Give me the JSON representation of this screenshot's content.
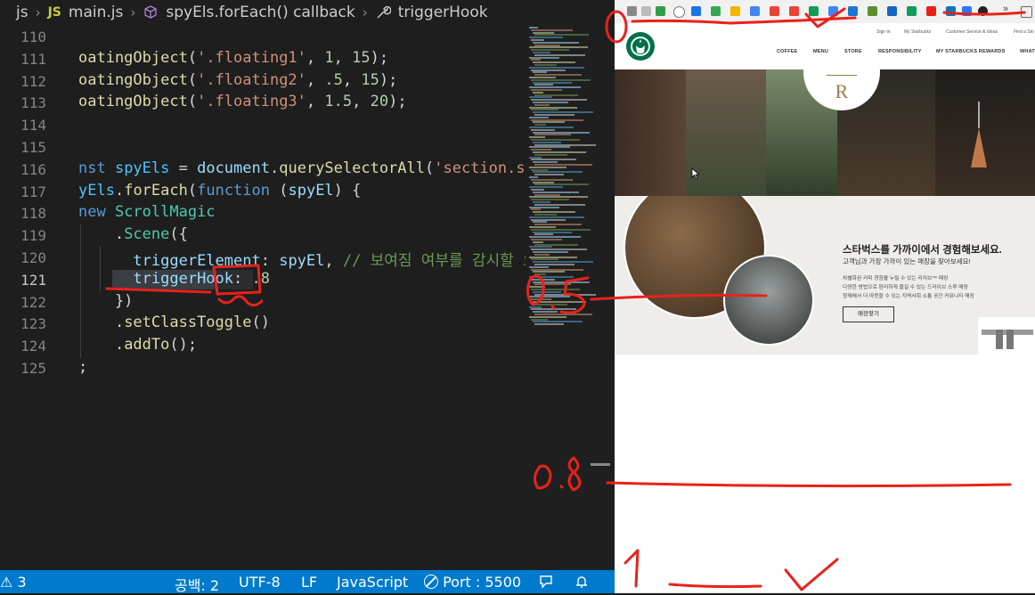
{
  "breadcrumb": {
    "items": [
      "js",
      "main.js",
      "spyEls.forEach() callback",
      "triggerHook"
    ],
    "js_badge": "JS"
  },
  "editor": {
    "lines": [
      {
        "num": "110",
        "tokens": []
      },
      {
        "num": "111",
        "tokens": [
          {
            "t": "oatingObject",
            "c": "fn"
          },
          {
            "t": "(",
            "c": ""
          },
          {
            "t": "'.floating1'",
            "c": "str"
          },
          {
            "t": ", ",
            "c": ""
          },
          {
            "t": "1",
            "c": "num"
          },
          {
            "t": ", ",
            "c": ""
          },
          {
            "t": "15",
            "c": "num"
          },
          {
            "t": ");",
            "c": ""
          }
        ]
      },
      {
        "num": "112",
        "tokens": [
          {
            "t": "oatingObject",
            "c": "fn"
          },
          {
            "t": "(",
            "c": ""
          },
          {
            "t": "'.floating2'",
            "c": "str"
          },
          {
            "t": ", ",
            "c": ""
          },
          {
            "t": ".5",
            "c": "num"
          },
          {
            "t": ", ",
            "c": ""
          },
          {
            "t": "15",
            "c": "num"
          },
          {
            "t": ");",
            "c": ""
          }
        ]
      },
      {
        "num": "113",
        "tokens": [
          {
            "t": "oatingObject",
            "c": "fn"
          },
          {
            "t": "(",
            "c": ""
          },
          {
            "t": "'.floating3'",
            "c": "str"
          },
          {
            "t": ", ",
            "c": ""
          },
          {
            "t": "1.5",
            "c": "num"
          },
          {
            "t": ", ",
            "c": ""
          },
          {
            "t": "20",
            "c": "num"
          },
          {
            "t": ");",
            "c": ""
          }
        ]
      },
      {
        "num": "114",
        "tokens": []
      },
      {
        "num": "115",
        "tokens": []
      },
      {
        "num": "116",
        "tokens": [
          {
            "t": "nst ",
            "c": "kw"
          },
          {
            "t": "spyEls",
            "c": "cst"
          },
          {
            "t": " = ",
            "c": ""
          },
          {
            "t": "document",
            "c": "var"
          },
          {
            "t": ".",
            "c": ""
          },
          {
            "t": "querySelectorAll",
            "c": "fn"
          },
          {
            "t": "(",
            "c": ""
          },
          {
            "t": "'section.sc",
            "c": "str"
          }
        ]
      },
      {
        "num": "117",
        "tokens": [
          {
            "t": "yEls",
            "c": "cst"
          },
          {
            "t": ".",
            "c": ""
          },
          {
            "t": "forEach",
            "c": "fn"
          },
          {
            "t": "(",
            "c": ""
          },
          {
            "t": "function",
            "c": "kw"
          },
          {
            "t": " (",
            "c": ""
          },
          {
            "t": "spyEl",
            "c": "var"
          },
          {
            "t": ") {",
            "c": ""
          }
        ]
      },
      {
        "num": "118",
        "tokens": [
          {
            "t": "new ",
            "c": "kw"
          },
          {
            "t": "ScrollMagic",
            "c": "cls"
          }
        ]
      },
      {
        "num": "119",
        "tokens": [
          {
            "t": "    .",
            "c": ""
          },
          {
            "t": "Scene",
            "c": "cls"
          },
          {
            "t": "({",
            "c": ""
          }
        ]
      },
      {
        "num": "120",
        "tokens": [
          {
            "t": "      ",
            "c": ""
          },
          {
            "t": "triggerElement",
            "c": "var"
          },
          {
            "t": ": ",
            "c": ""
          },
          {
            "t": "spyEl",
            "c": "var"
          },
          {
            "t": ", ",
            "c": ""
          },
          {
            "t": "// 보여짐 여부를 감시할 요소를",
            "c": "cm"
          }
        ]
      },
      {
        "num": "121",
        "tokens": [
          {
            "t": "      ",
            "c": ""
          },
          {
            "t": "triggerHook",
            "c": "var"
          },
          {
            "t": ": ",
            "c": ""
          },
          {
            "t": ".8",
            "c": "num"
          }
        ]
      },
      {
        "num": "122",
        "tokens": [
          {
            "t": "    })",
            "c": ""
          }
        ]
      },
      {
        "num": "123",
        "tokens": [
          {
            "t": "    .",
            "c": ""
          },
          {
            "t": "setClassToggle",
            "c": "fn"
          },
          {
            "t": "()",
            "c": ""
          }
        ]
      },
      {
        "num": "124",
        "tokens": [
          {
            "t": "    .",
            "c": ""
          },
          {
            "t": "addTo",
            "c": "fn"
          },
          {
            "t": "();",
            "c": ""
          }
        ]
      },
      {
        "num": "125",
        "tokens": [
          {
            "t": ";",
            "c": ""
          }
        ]
      }
    ]
  },
  "status": {
    "errors": "3",
    "indent": "공백: 2",
    "encoding": "UTF-8",
    "eol": "LF",
    "language": "JavaScript",
    "port": "Port : 5500"
  },
  "browser": {
    "top_links": [
      "Sign In",
      "My Starbucks",
      "Customer Service & Ideas",
      "Find a Sto"
    ],
    "nav": [
      "COFFEE",
      "MENU",
      "STORE",
      "RESPONSIBILITY",
      "MY STARBUCKS REWARDS",
      "WHAT"
    ],
    "hero_badge": "R",
    "store_title": "스타벅스를 가까이에서 경험해보세요.",
    "store_subtitle": "고객님과 가장 가까이 있는 매장을 찾아보세요!",
    "store_desc": [
      "차별화된 커피 경험을 누릴 수 있는 리저브™ 매장",
      "다양한 방법으로 편리하게 즐길 수 있는 드라이브 스루 매장",
      "함께해서 더 따뜻할 수 있는 지역사회 소통 공간 커뮤니티 매장"
    ],
    "store_button": "매장찾기"
  },
  "annotations": {
    "label_top": "0",
    "label_mid": "0.5",
    "label_80": "0.8",
    "label_bottom": "1"
  },
  "colors": {
    "status_bar": "#007acc",
    "editor_bg": "#1e1e1e",
    "annotation_red": "#e8221b",
    "starbucks_green": "#00704a"
  }
}
